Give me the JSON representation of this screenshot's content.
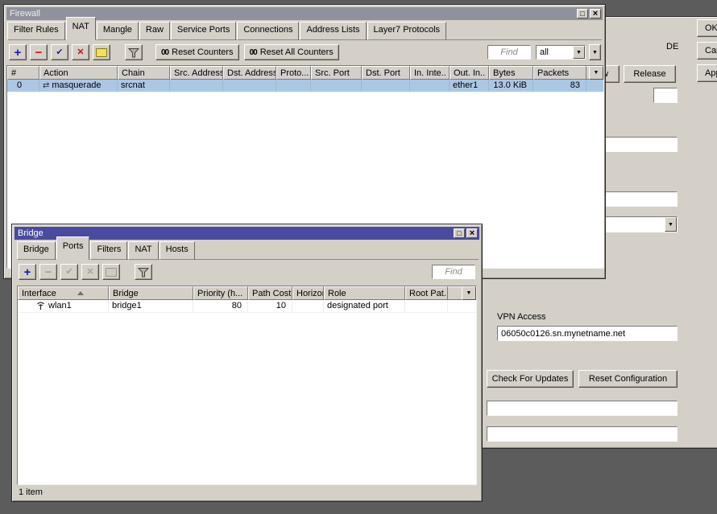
{
  "colors": {
    "desktop": "#5c5c5c",
    "window_face": "#d4d0c8",
    "active_titlebar": "#4a4aa0",
    "inactive_titlebar": "#8f929c",
    "selection": "#aac8e6",
    "add_icon_blue": "#1414d6",
    "remove_icon_red": "#cc1111"
  },
  "icons": {
    "add": "+",
    "remove": "−",
    "enable": "✔",
    "disable": "✕",
    "dropdown": "▼",
    "maximize": "□",
    "close": "×",
    "masquerade": "⇄"
  },
  "firewall": {
    "title": "Firewall",
    "tabs": [
      "Filter Rules",
      "NAT",
      "Mangle",
      "Raw",
      "Service Ports",
      "Connections",
      "Address Lists",
      "Layer7 Protocols"
    ],
    "active_tab": "NAT",
    "toolbar": {
      "counter_badge": "00",
      "reset_counters": "Reset Counters",
      "reset_all": "Reset All Counters",
      "find_placeholder": "Find",
      "scope": "all"
    },
    "columns": [
      "#",
      "Action",
      "Chain",
      "Src. Address",
      "Dst. Address",
      "Proto...",
      "Src. Port",
      "Dst. Port",
      "In. Inte..",
      "Out. In..",
      "Bytes",
      "Packets"
    ],
    "row": {
      "num": "0",
      "action": "masquerade",
      "chain": "srcnat",
      "src_address": "",
      "dst_address": "",
      "protocol": "",
      "src_port": "",
      "dst_port": "",
      "in_interface": "",
      "out_interface": "ether1",
      "bytes": "13.0 KiB",
      "packets": "83"
    }
  },
  "bridge": {
    "title": "Bridge",
    "tabs": [
      "Bridge",
      "Ports",
      "Filters",
      "NAT",
      "Hosts"
    ],
    "active_tab": "Ports",
    "toolbar": {
      "find_placeholder": "Find"
    },
    "columns": [
      "Interface",
      "Bridge",
      "Priority (h...",
      "Path Cost",
      "Horizon",
      "Role",
      "Root Pat..."
    ],
    "row": {
      "interface": "wlan1",
      "bridge": "bridge1",
      "priority": "80",
      "path_cost": "10",
      "horizon": "",
      "role": "designated port",
      "root_path": ""
    },
    "status": "1 item"
  },
  "background": {
    "fragment_label": "DE",
    "renew": "Renew",
    "release": "Release",
    "vpn_access": "VPN Access",
    "vpn_address": "06050c0126.sn.mynetname.net",
    "check_updates": "Check For Updates",
    "reset_configuration": "Reset Configuration",
    "ok": "OK",
    "cancel": "Cancel",
    "apply": "Apply"
  }
}
